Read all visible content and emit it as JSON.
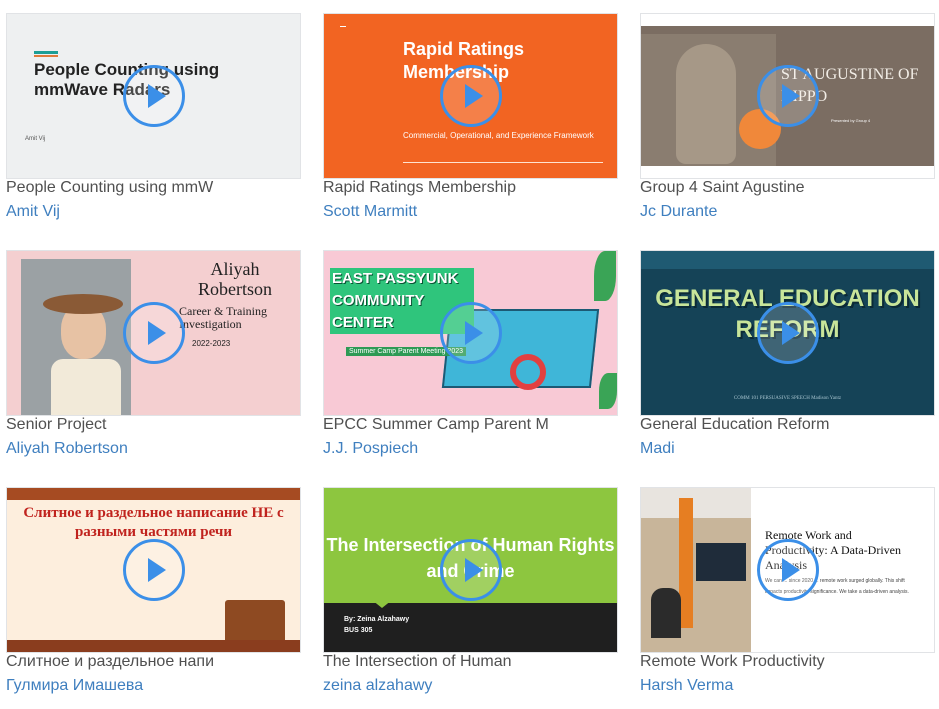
{
  "cards": [
    {
      "title": "People Counting using mmW",
      "author": "Amit Vij",
      "slide_title": "People Counting using mmWave Radars",
      "slide_sub": "Amit Vij"
    },
    {
      "title": "Rapid Ratings Membership",
      "author": "Scott Marmitt",
      "slide_title": "Rapid Ratings Membership",
      "slide_sub": "Commercial, Operational, and Experience Framework"
    },
    {
      "title": "Group 4 Saint Agustine",
      "author": "Jc Durante",
      "slide_title": "ST AUGUSTINE OF HIPPO",
      "slide_sub": "Presented by Group 4"
    },
    {
      "title": "Senior Project",
      "author": "Aliyah Robertson",
      "slide_title": "Aliyah Robertson",
      "slide_sub": "Career & Training Investigation",
      "slide_date": "2022-2023"
    },
    {
      "title": "EPCC Summer Camp Parent M",
      "author": "J.J. Pospiech",
      "slide_title": "EAST PASSYUNK COMMUNITY CENTER",
      "slide_sub": "Summer Camp Parent Meeting 2023"
    },
    {
      "title": "General Education Reform",
      "author": "Madi",
      "slide_title": "GENERAL EDUCATION REFORM",
      "slide_sub": "COMM 101 PERSUASIVE SPEECH Madison Yantz"
    },
    {
      "title": "Слитное и раздельное напи",
      "author": "Гулмира Имашева",
      "slide_title": "Слитное и раздельное написание  НЕ с разными частями речи"
    },
    {
      "title": "The Intersection of Human",
      "author": "zeina alzahawy",
      "slide_title": "The Intersection of Human Rights and Crime",
      "slide_sub": "By: Zeina Alzahawy",
      "slide_sub2": "BUS 305"
    },
    {
      "title": "Remote Work Productivity",
      "author": "Harsh Verma",
      "slide_title": "Remote Work and Productivity: A Data-Driven Analysis",
      "slide_sub": "We can ... since 2020 ... remote work surged globally. This shift impacts productivity significance. We take a data-driven analysis."
    }
  ],
  "colors": {
    "play": "#3b8fe8",
    "author": "#3f7fbf",
    "title": "#505050"
  }
}
